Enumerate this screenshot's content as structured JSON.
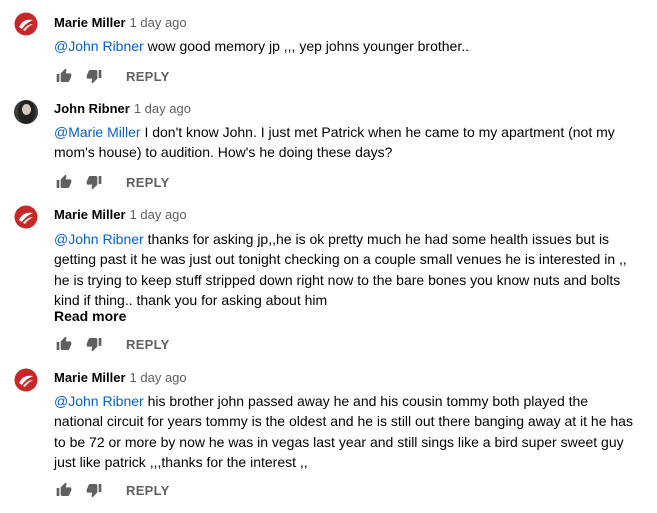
{
  "comments": [
    {
      "author": "Marie Miller",
      "time": "1 day ago",
      "mention": "@John Ribner",
      "lines": [
        " wow good memory jp ,,, yep johns younger brother.."
      ],
      "reply_label": "REPLY"
    },
    {
      "author": "John Ribner",
      "time": "1 day ago",
      "mention": "@Marie Miller",
      "lines": [
        " I don't know John. I just met Patrick when he came to my apartment (not my",
        "mom's house) to audition. How's he doing these days?"
      ],
      "reply_label": "REPLY"
    },
    {
      "author": "Marie Miller",
      "time": "1 day ago",
      "mention": "@John Ribner",
      "lines": [
        " thanks for asking jp,,he is ok pretty much he had some health issues but is",
        "getting past it he was just out tonight checking on a couple small venues he is interested in ,,",
        "he is trying to keep stuff stripped down right now to the bare bones you know nuts and bolts",
        "kind if thing.. thank you for asking about him"
      ],
      "read_more": "Read more",
      "reply_label": "REPLY"
    },
    {
      "author": "Marie Miller",
      "time": "1 day ago",
      "mention": "@John Ribner",
      "lines": [
        " his brother john passed away he and his cousin  tommy both played the",
        "national circuit for years tommy is the oldest and he is still out there banging away at it he has",
        "to be 72 or more by now he was in vegas last year and still sings like a bird super sweet guy",
        "just like patrick ,,,thanks for the interest ,,"
      ],
      "reply_label": "REPLY"
    }
  ],
  "icons": {
    "like": "thumb-up-icon",
    "dislike": "thumb-down-icon",
    "avatar_marie": "red-circle-logo-icon",
    "avatar_john": "portrait-photo-icon"
  },
  "colors": {
    "mention": "#065fd4",
    "meta": "#606060",
    "text": "#030303",
    "avatar_marie": "#c62828"
  }
}
